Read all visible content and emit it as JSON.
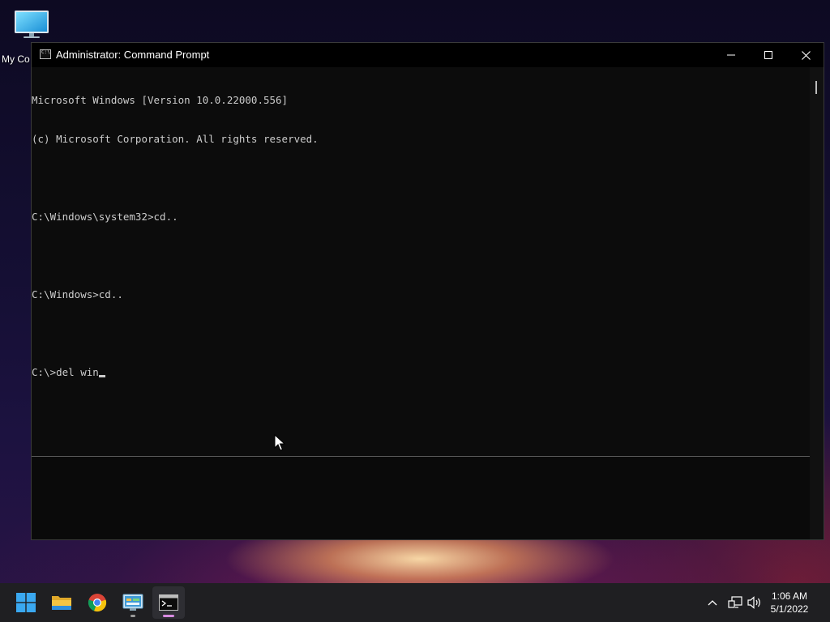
{
  "desktop": {
    "icons": [
      {
        "label": "My Co",
        "icon": "computer-icon"
      }
    ]
  },
  "window": {
    "title": "Administrator: Command Prompt",
    "controls": {
      "minimize": "minimize-icon",
      "maximize": "maximize-icon",
      "close": "close-icon"
    }
  },
  "console": {
    "lines": [
      "Microsoft Windows [Version 10.0.22000.556]",
      "(c) Microsoft Corporation. All rights reserved.",
      "",
      "C:\\Windows\\system32>cd..",
      "",
      "C:\\Windows>cd..",
      "",
      "C:\\>del win"
    ]
  },
  "taskbar": {
    "apps": [
      {
        "name": "start",
        "icon": "windows-logo-icon"
      },
      {
        "name": "file-explorer",
        "icon": "folder-icon"
      },
      {
        "name": "chrome",
        "icon": "chrome-icon"
      },
      {
        "name": "control-panel",
        "icon": "control-panel-icon",
        "running": true
      },
      {
        "name": "command-prompt",
        "icon": "terminal-icon",
        "active": true
      }
    ],
    "tray": {
      "icons": [
        "chevron-up-icon",
        "network-icon",
        "volume-icon"
      ],
      "time": "1:06 AM",
      "date": "5/1/2022"
    }
  },
  "colors": {
    "console_bg": "#0c0c0c",
    "console_text": "#cccccc",
    "taskbar_bg": "#1f1f22",
    "active_indicator": "#d78be0"
  }
}
